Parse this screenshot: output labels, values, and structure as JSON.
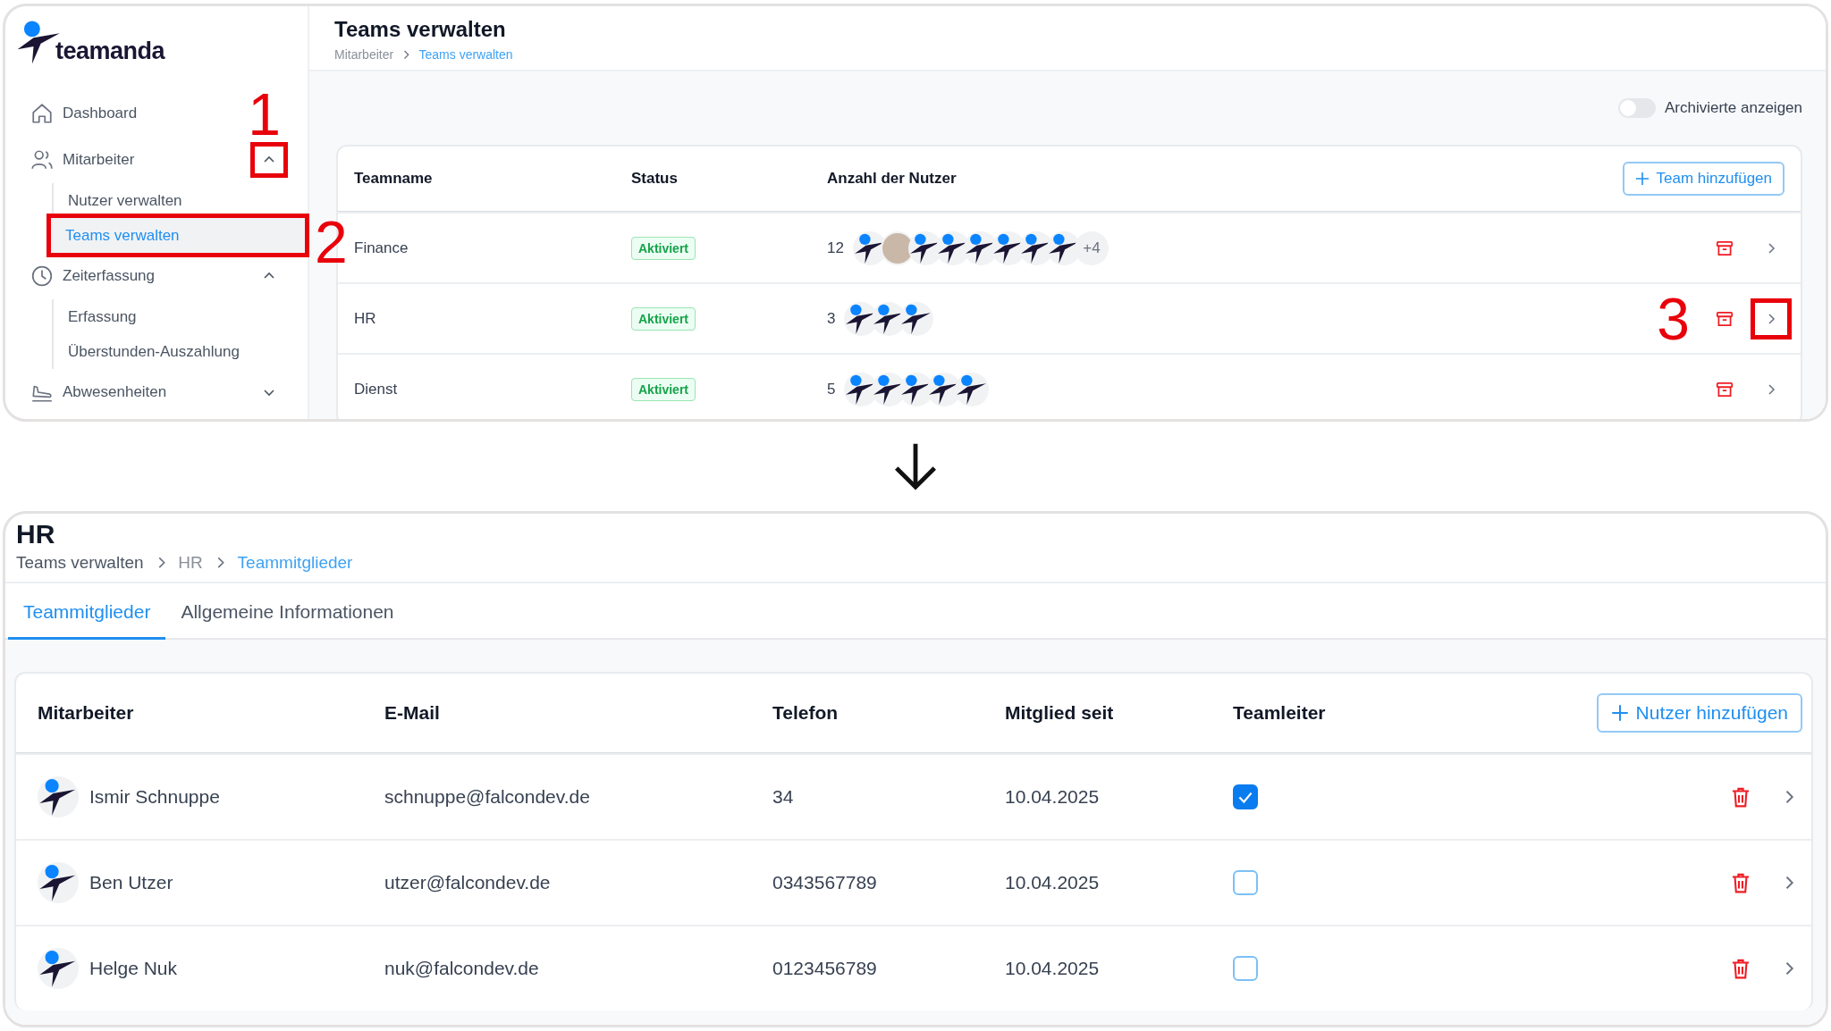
{
  "top": {
    "logo": {
      "text": "teamanda"
    },
    "sidebar": {
      "items": [
        {
          "label": "Dashboard",
          "kind": "link"
        },
        {
          "label": "Mitarbeiter",
          "kind": "group",
          "expanded": true,
          "marker": "1",
          "children": [
            {
              "label": "Nutzer verwalten",
              "selected": false
            },
            {
              "label": "Teams verwalten",
              "selected": true,
              "marker": "2"
            }
          ]
        },
        {
          "label": "Zeiterfassung",
          "kind": "group",
          "expanded": true,
          "children": [
            {
              "label": "Erfassung",
              "selected": false
            },
            {
              "label": "Überstunden-Auszahlung",
              "selected": false
            }
          ]
        },
        {
          "label": "Abwesenheiten",
          "kind": "group",
          "expanded": false
        }
      ]
    },
    "header": {
      "title": "Teams verwalten",
      "breadcrumb": [
        {
          "label": "Mitarbeiter",
          "current": false
        },
        {
          "label": "Teams verwalten",
          "current": true
        }
      ]
    },
    "toggle": {
      "label": "Archivierte anzeigen",
      "on": false
    },
    "table": {
      "columns": [
        "Teamname",
        "Status",
        "Anzahl der Nutzer"
      ],
      "add_button": "Team hinzufügen",
      "rows": [
        {
          "name": "Finance",
          "status": "Aktiviert",
          "count": "12",
          "avatars": [
            {
              "kind": "logo"
            },
            {
              "kind": "photo"
            },
            {
              "kind": "logo"
            },
            {
              "kind": "logo"
            },
            {
              "kind": "logo"
            },
            {
              "kind": "logo"
            },
            {
              "kind": "logo"
            },
            {
              "kind": "logo"
            }
          ],
          "more": "+4"
        },
        {
          "name": "HR",
          "status": "Aktiviert",
          "count": "3",
          "avatars": [
            {
              "kind": "logo"
            },
            {
              "kind": "logo"
            },
            {
              "kind": "logo"
            }
          ],
          "marker": "3"
        },
        {
          "name": "Dienst",
          "status": "Aktiviert",
          "count": "5",
          "avatars": [
            {
              "kind": "logo"
            },
            {
              "kind": "logo"
            },
            {
              "kind": "logo"
            },
            {
              "kind": "logo"
            },
            {
              "kind": "logo"
            }
          ]
        }
      ]
    }
  },
  "bottom": {
    "header": {
      "title": "HR",
      "breadcrumb": [
        {
          "label": "Teams verwalten",
          "current": false
        },
        {
          "label": "HR",
          "current": false
        },
        {
          "label": "Teammitglieder",
          "current": true
        }
      ]
    },
    "tabs": [
      {
        "label": "Teammitglieder",
        "selected": true
      },
      {
        "label": "Allgemeine Informationen",
        "selected": false
      }
    ],
    "table": {
      "columns": [
        "Mitarbeiter",
        "E-Mail",
        "Telefon",
        "Mitglied seit",
        "Teamleiter"
      ],
      "add_button": "Nutzer hinzufügen",
      "rows": [
        {
          "name": "Ismir Schnuppe",
          "email": "schnuppe@falcondev.de",
          "phone": "34",
          "since": "10.04.2025",
          "leader": true
        },
        {
          "name": "Ben Utzer",
          "email": "utzer@falcondev.de",
          "phone": "0343567789",
          "since": "10.04.2025",
          "leader": false
        },
        {
          "name": "Helge Nuk",
          "email": "nuk@falcondev.de",
          "phone": "0123456789",
          "since": "10.04.2025",
          "leader": false
        }
      ]
    }
  }
}
